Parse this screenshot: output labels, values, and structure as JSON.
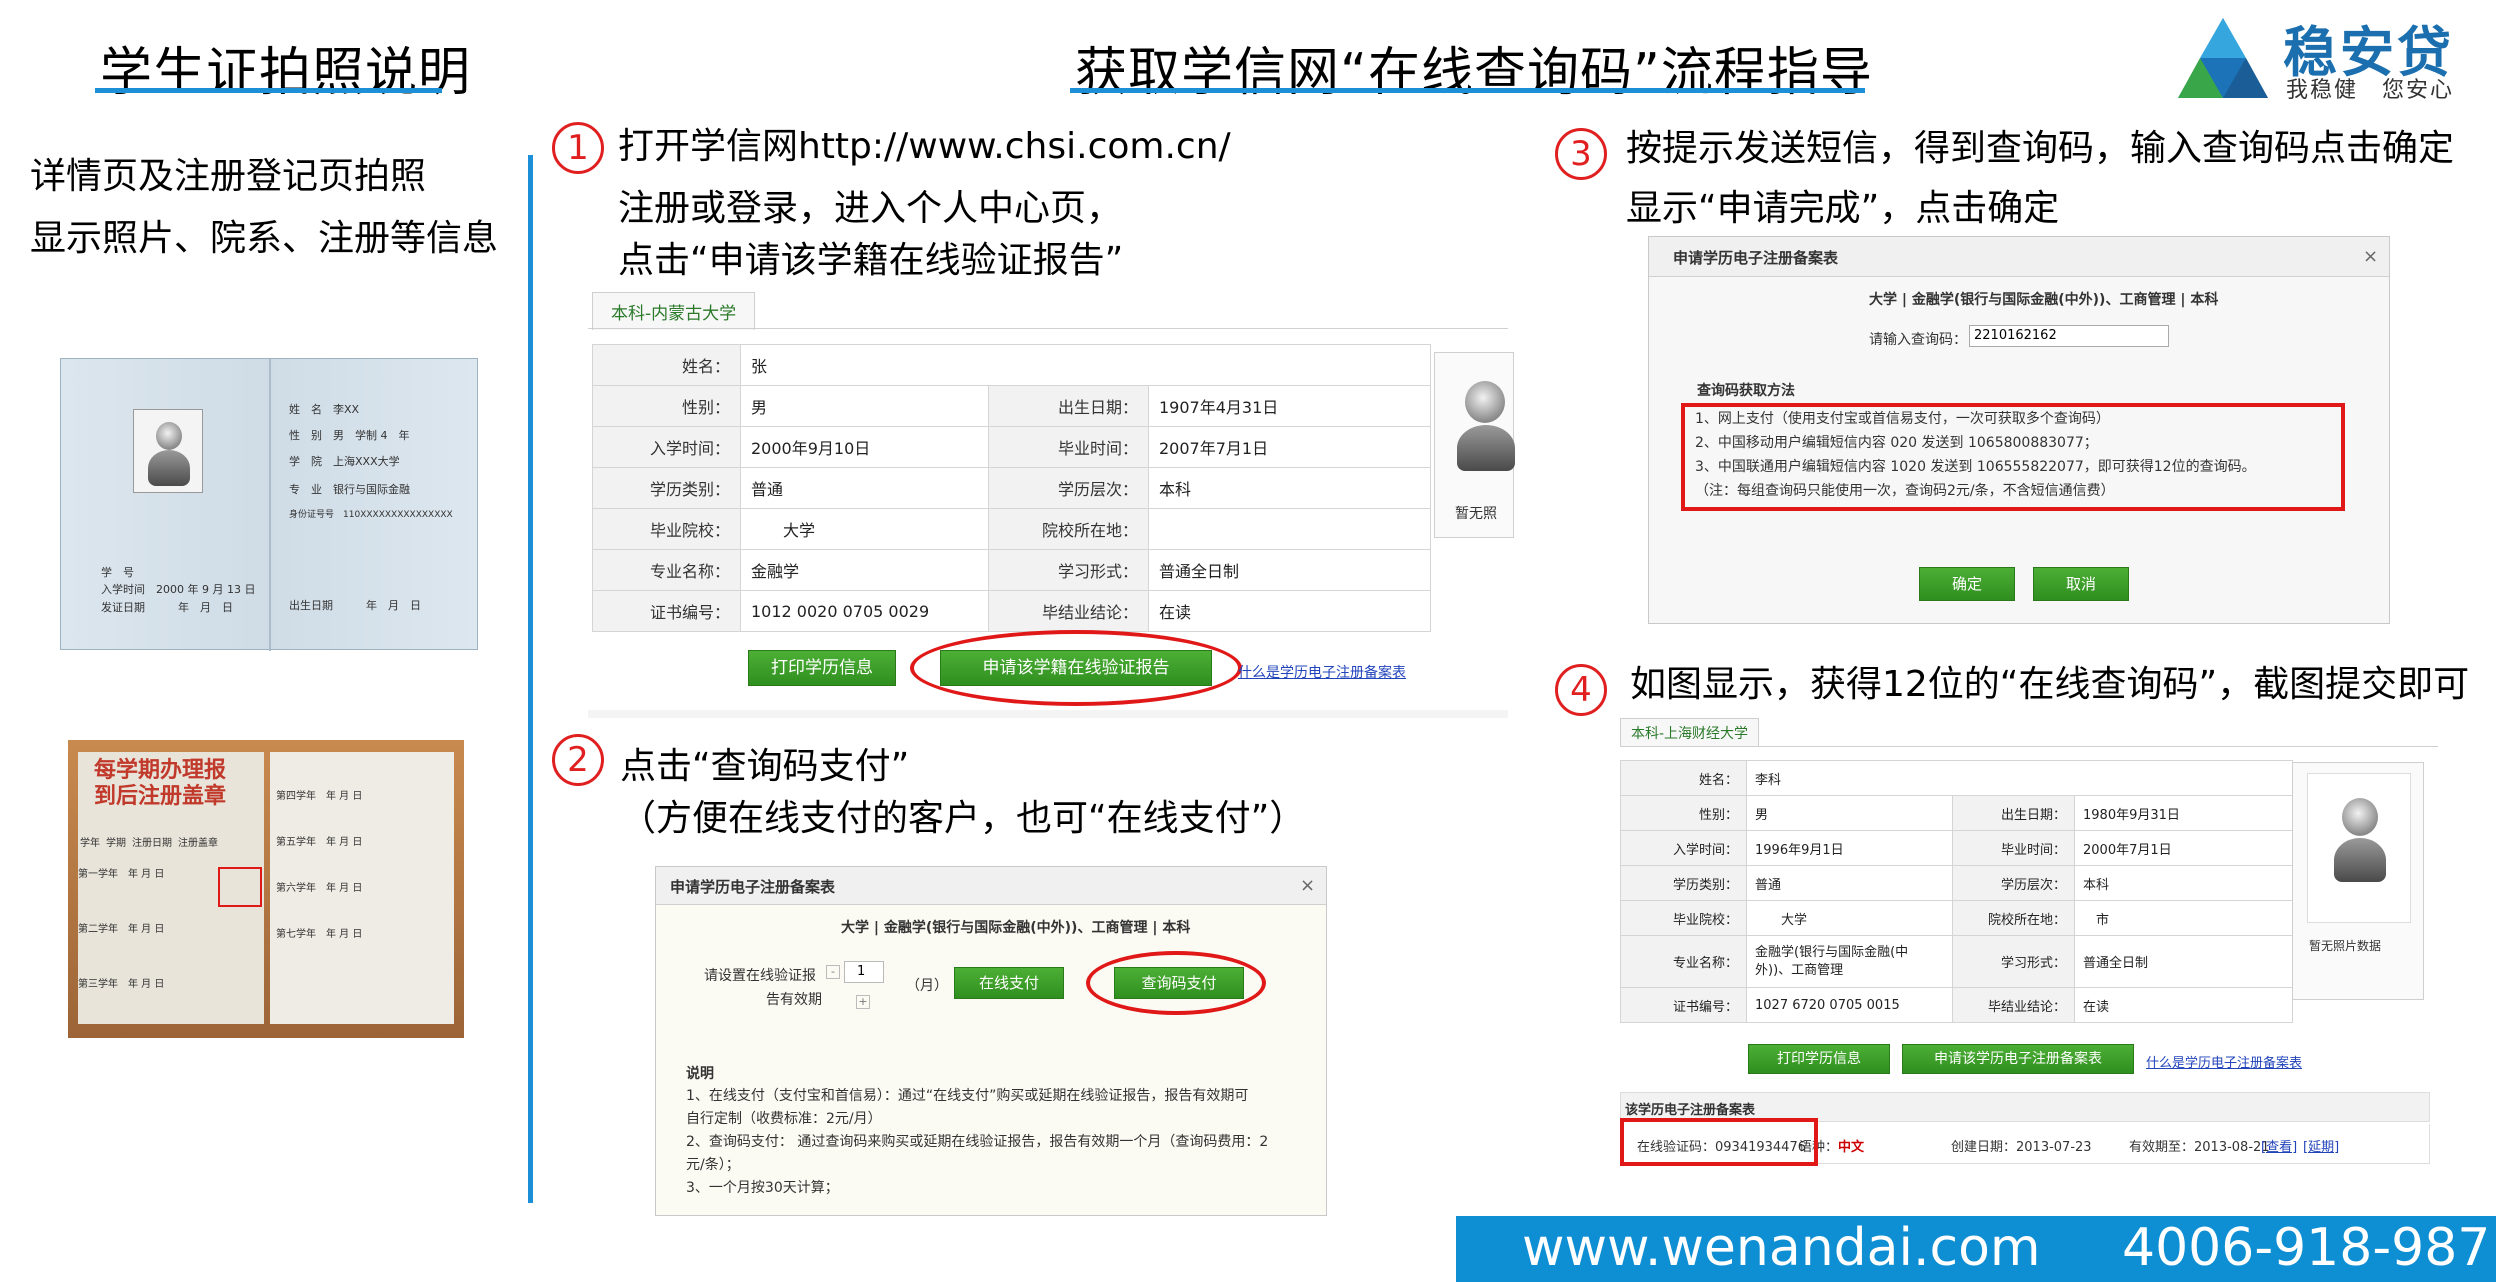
{
  "header": {
    "left_title": "学生证拍照说明",
    "center_title": "获取学信网“在线查询码”流程指导"
  },
  "logo": {
    "brand": "稳安贷",
    "slogan": "我稳健　您安心"
  },
  "left_panel": {
    "line1": "详情页及注册登记页拍照",
    "line2": "显示照片、院系、注册等信息",
    "card": {
      "name_label": "姓　名",
      "name_value": "李XX",
      "gender_label": "性　别",
      "gender_value": "男",
      "years_label": "学制",
      "years_value": "4　年",
      "school_label": "学　院",
      "school_value": "上海XXX大学",
      "major_label": "专　业",
      "major_value": "银行与国际金融",
      "id_label": "身份证号号",
      "id_value": "110XXXXXXXXXXXXXXX",
      "no_label": "学　号",
      "enroll_label": "入学时间",
      "enroll_value": "2000 年 9 月 13 日",
      "issue_label": "发证日期",
      "issue_value": "年　月　日",
      "birth_label": "出生日期",
      "birth_value": "年　月　日"
    },
    "reg_book": {
      "stamp": "每学期办理报到后注册盖章",
      "header_cells": [
        "学年",
        "学期",
        "注册日期",
        "注册盖章"
      ],
      "date_cell": "年 月 日",
      "rows": [
        "第一学年",
        "第二学年",
        "第三学年"
      ],
      "right_rows": [
        "第四学年",
        "第五学年",
        "第六学年",
        "第七学年"
      ]
    }
  },
  "steps": {
    "step1": {
      "num": "1",
      "line1": "打开学信网http://www.chsi.com.cn/",
      "line2": "注册或登录，进入个人中心页，",
      "line3": "点击“申请该学籍在线验证报告”"
    },
    "step2": {
      "num": "2",
      "line1": "点击“查询码支付”",
      "line2": "（方便在线支付的客户，也可“在线支付”）"
    },
    "step3": {
      "num": "3",
      "line1": "按提示发送短信，得到查询码，输入查询码点击确定",
      "line2": "显示“申请完成”，点击确定"
    },
    "step4": {
      "num": "4",
      "line1": "如图显示，获得12位的“在线查询码”，截图提交即可"
    }
  },
  "shot1": {
    "tab": "本科-内蒙古大学",
    "rows": [
      [
        "姓名：",
        "张",
        "",
        ""
      ],
      [
        "性别：",
        "男",
        "出生日期：",
        "1907年4月31日"
      ],
      [
        "入学时间：",
        "2000年9月10日",
        "毕业时间：",
        "2007年7月1日"
      ],
      [
        "学历类别：",
        "普通",
        "学历层次：",
        "本科"
      ],
      [
        "毕业院校：",
        "　　大学",
        "院校所在地：",
        ""
      ],
      [
        "专业名称：",
        "金融学",
        "学习形式：",
        "普通全日制"
      ],
      [
        "证书编号：",
        "1012 0020 0705 0029",
        "毕结业结论：",
        "在读"
      ]
    ],
    "photo_caption": "暂无照",
    "btn_print": "打印学历信息",
    "btn_apply": "申请该学籍在线验证报告",
    "link": "什么是学历电子注册备案表"
  },
  "shot2": {
    "title": "申请学历电子注册备案表",
    "close": "×",
    "subtitle": "大学 | 金融学(银行与国际金融(中外))、工商管理 | 本科",
    "validity_label_1": "请设置在线验证报",
    "validity_label_2": "告有效期",
    "minus": "-",
    "plus": "+",
    "months_value": "1",
    "months_unit": "（月）",
    "btn_online": "在线支付",
    "btn_code": "查询码支付",
    "notes_title": "说明",
    "notes": [
      "1、在线支付（支付宝和首信易）：通过“在线支付”购买或延期在线验证报告，报告有效期可",
      "自行定制（收费标准：2元/月）",
      "2、查询码支付： 通过查询码来购买或延期在线验证报告，报告有效期一个月（查询码费用：2",
      "元/条）；",
      "3、一个月按30天计算；"
    ]
  },
  "shot3": {
    "title": "申请学历电子注册备案表",
    "close": "×",
    "subtitle": "大学 | 金融学(银行与国际金融(中外))、工商管理 | 本科",
    "input_label": "请输入查询码：",
    "input_value": "2210162162",
    "method_title": "查询码获取方法",
    "method_1_link": "网上支付",
    "method_1": "1、网上支付（使用支付宝或首信易支付，一次可获取多个查询码）",
    "method_2": "2、中国移动用户编辑短信内容 020 发送到 1065800883077；",
    "method_3": "3、中国联通用户编辑短信内容 1020 发送到 106555822077，即可获得12位的查询码。",
    "method_note": "（注：每组查询码只能使用一次，查询码2元/条，不含短信通信费）",
    "btn_ok": "确定",
    "btn_cancel": "取消"
  },
  "shot4": {
    "tab": "本科-上海财经大学",
    "rows": [
      [
        "姓名：",
        "李科",
        "",
        ""
      ],
      [
        "性别：",
        "男",
        "出生日期：",
        "1980年9月31日"
      ],
      [
        "入学时间：",
        "1996年9月1日",
        "毕业时间：",
        "2000年7月1日"
      ],
      [
        "学历类别：",
        "普通",
        "学历层次：",
        "本科"
      ],
      [
        "毕业院校：",
        "　　大学",
        "院校所在地：",
        "　市"
      ],
      [
        "专业名称：",
        "金融学(银行与国际金融(中外))、工商管理",
        "学习形式：",
        "普通全日制"
      ],
      [
        "证书编号：",
        "1027 6720 0705 0015",
        "毕结业结论：",
        "在读"
      ]
    ],
    "photo_caption": "暂无照片数据",
    "btn_print": "打印学历信息",
    "btn_apply": "申请该学历电子注册备案表",
    "link": "什么是学历电子注册备案表",
    "record_title": "该学历电子注册备案表",
    "code_label": "在线验证码：09341934476",
    "lang_label": "语种：",
    "lang_value": "中文",
    "created": "创建日期：2013-07-23",
    "expires": "有效期至：2013-08-21",
    "view": "[查看]",
    "extend": "[延期]"
  },
  "footer": {
    "website": "www.wenandai.com",
    "phone": "4006-918-987"
  },
  "colors": {
    "accent_blue": "#1d8fd6",
    "highlight_red": "#e01818",
    "button_green": "#3a9f28",
    "footer_blue": "#0f8fd3"
  }
}
